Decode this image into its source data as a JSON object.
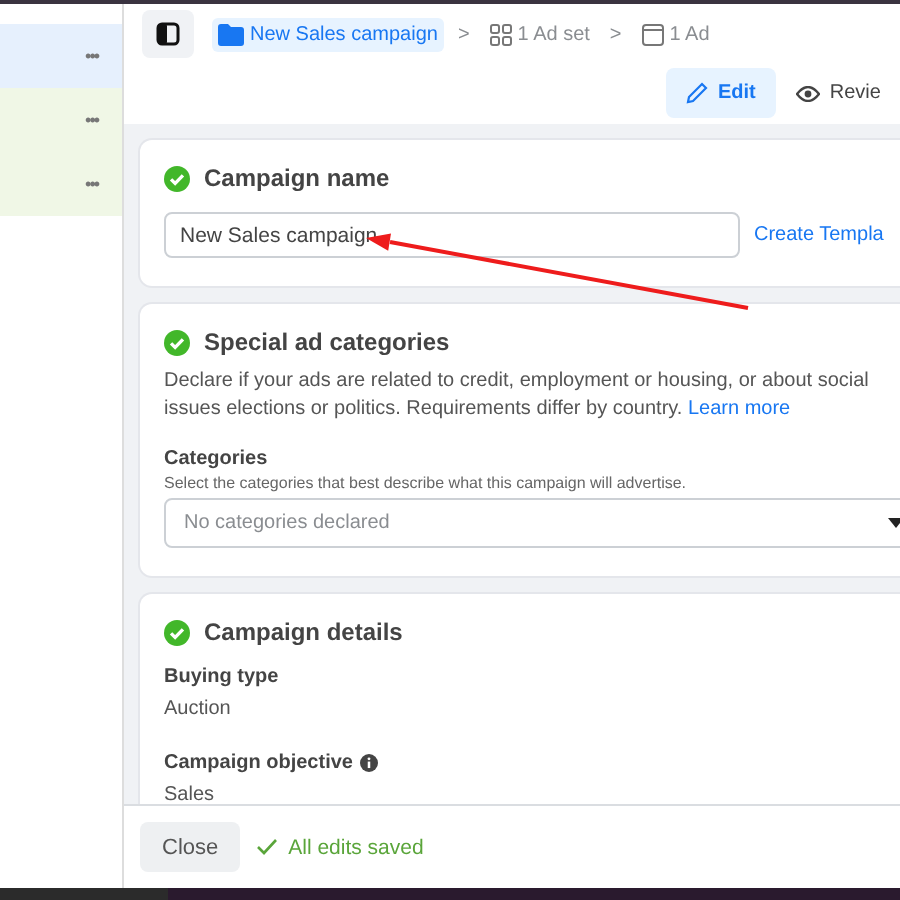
{
  "sidebar": {
    "rows": [
      {
        "color": "#e6f0fd",
        "menu": "•••"
      },
      {
        "color": "#f0f7e6",
        "menu": "•••"
      },
      {
        "color": "#f0f7e6",
        "menu": "•••"
      }
    ]
  },
  "breadcrumb": {
    "campaign": "New Sales campaign",
    "separator_1": ">",
    "ad_set": "1 Ad set",
    "separator_2": ">",
    "ad": "1 Ad"
  },
  "modes": [
    {
      "label": "Edit",
      "selected": true
    },
    {
      "label": "Revie",
      "selected": false
    }
  ],
  "campaign_name": {
    "title": "Campaign name",
    "complete": true,
    "value": "New Sales campaign",
    "link": "Create Templa"
  },
  "special_ad_categories": {
    "title": "Special ad categories",
    "complete": true,
    "description": "Declare if your ads are related to credit, employment or housing, or about social issues elections or politics. Requirements differ by country.",
    "link": "Learn more",
    "field_label": "Categories",
    "field_hint": "Select the categories that best describe what this campaign will advertise.",
    "placeholder": "No categories declared"
  },
  "campaign_details": {
    "title": "Campaign details",
    "complete": true,
    "fields": [
      {
        "label": "Buying type",
        "value": "Auction",
        "info": false
      },
      {
        "label": "Campaign objective",
        "value": "Sales",
        "info": true
      }
    ]
  },
  "footer": {
    "close": "Close",
    "status": "All edits saved"
  }
}
